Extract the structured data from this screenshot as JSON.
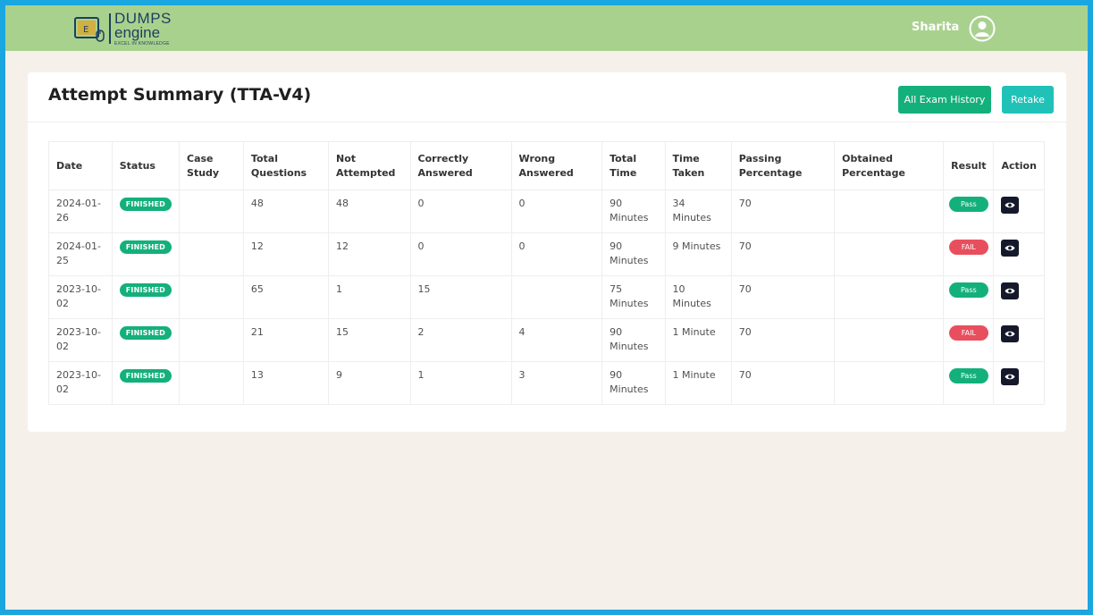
{
  "header": {
    "logo": {
      "line1": "DUMPS",
      "line2": "engine",
      "tagline": "EXCEL IN KNOWLEDGE"
    },
    "user_name": "Sharita",
    "bar_color": "#a9d18e"
  },
  "page": {
    "title": "Attempt Summary (TTA-V4)",
    "buttons": {
      "history": "All Exam History",
      "retake": "Retake"
    }
  },
  "table": {
    "headers": {
      "date": "Date",
      "status": "Status",
      "case_study": "Case Study",
      "total_questions": "Total Questions",
      "not_attempted": "Not Attempted",
      "correctly_answered": "Correctly Answered",
      "wrong_answered": "Wrong Answered",
      "total_time": "Total Time",
      "time_taken": "Time Taken",
      "passing_percentage": "Passing Percentage",
      "obtained_percentage": "Obtained Percentage",
      "result": "Result",
      "action": "Action"
    },
    "rows": [
      {
        "date": "2024-01-26",
        "status": "FINISHED",
        "case_study": "",
        "total_questions": "48",
        "not_attempted": "48",
        "correctly_answered": "0",
        "wrong_answered": "0",
        "total_time": "90 Minutes",
        "time_taken": "34 Minutes",
        "passing_percentage": "70",
        "obtained_percentage": "",
        "result": "Pass"
      },
      {
        "date": "2024-01-25",
        "status": "FINISHED",
        "case_study": "",
        "total_questions": "12",
        "not_attempted": "12",
        "correctly_answered": "0",
        "wrong_answered": "0",
        "total_time": "90 Minutes",
        "time_taken": "9 Minutes",
        "passing_percentage": "70",
        "obtained_percentage": "",
        "result": "FAIL"
      },
      {
        "date": "2023-10-02",
        "status": "FINISHED",
        "case_study": "",
        "total_questions": "65",
        "not_attempted": "1",
        "correctly_answered": "15",
        "wrong_answered": "",
        "total_time": "75 Minutes",
        "time_taken": "10 Minutes",
        "passing_percentage": "70",
        "obtained_percentage": "",
        "result": "Pass"
      },
      {
        "date": "2023-10-02",
        "status": "FINISHED",
        "case_study": "",
        "total_questions": "21",
        "not_attempted": "15",
        "correctly_answered": "2",
        "wrong_answered": "4",
        "total_time": "90 Minutes",
        "time_taken": "1 Minute",
        "passing_percentage": "70",
        "obtained_percentage": "",
        "result": "FAIL"
      },
      {
        "date": "2023-10-02",
        "status": "FINISHED",
        "case_study": "",
        "total_questions": "13",
        "not_attempted": "9",
        "correctly_answered": "1",
        "wrong_answered": "3",
        "total_time": "90 Minutes",
        "time_taken": "1 Minute",
        "passing_percentage": "70",
        "obtained_percentage": "",
        "result": "Pass"
      }
    ]
  },
  "colors": {
    "accent_green": "#14b07c",
    "accent_teal": "#20c2b8",
    "fail_red": "#e84f5e",
    "frame_blue": "#1aa6de"
  },
  "icons": {
    "user": "user-avatar-icon",
    "view": "eye-icon",
    "logo": "book-mouse-icon"
  }
}
